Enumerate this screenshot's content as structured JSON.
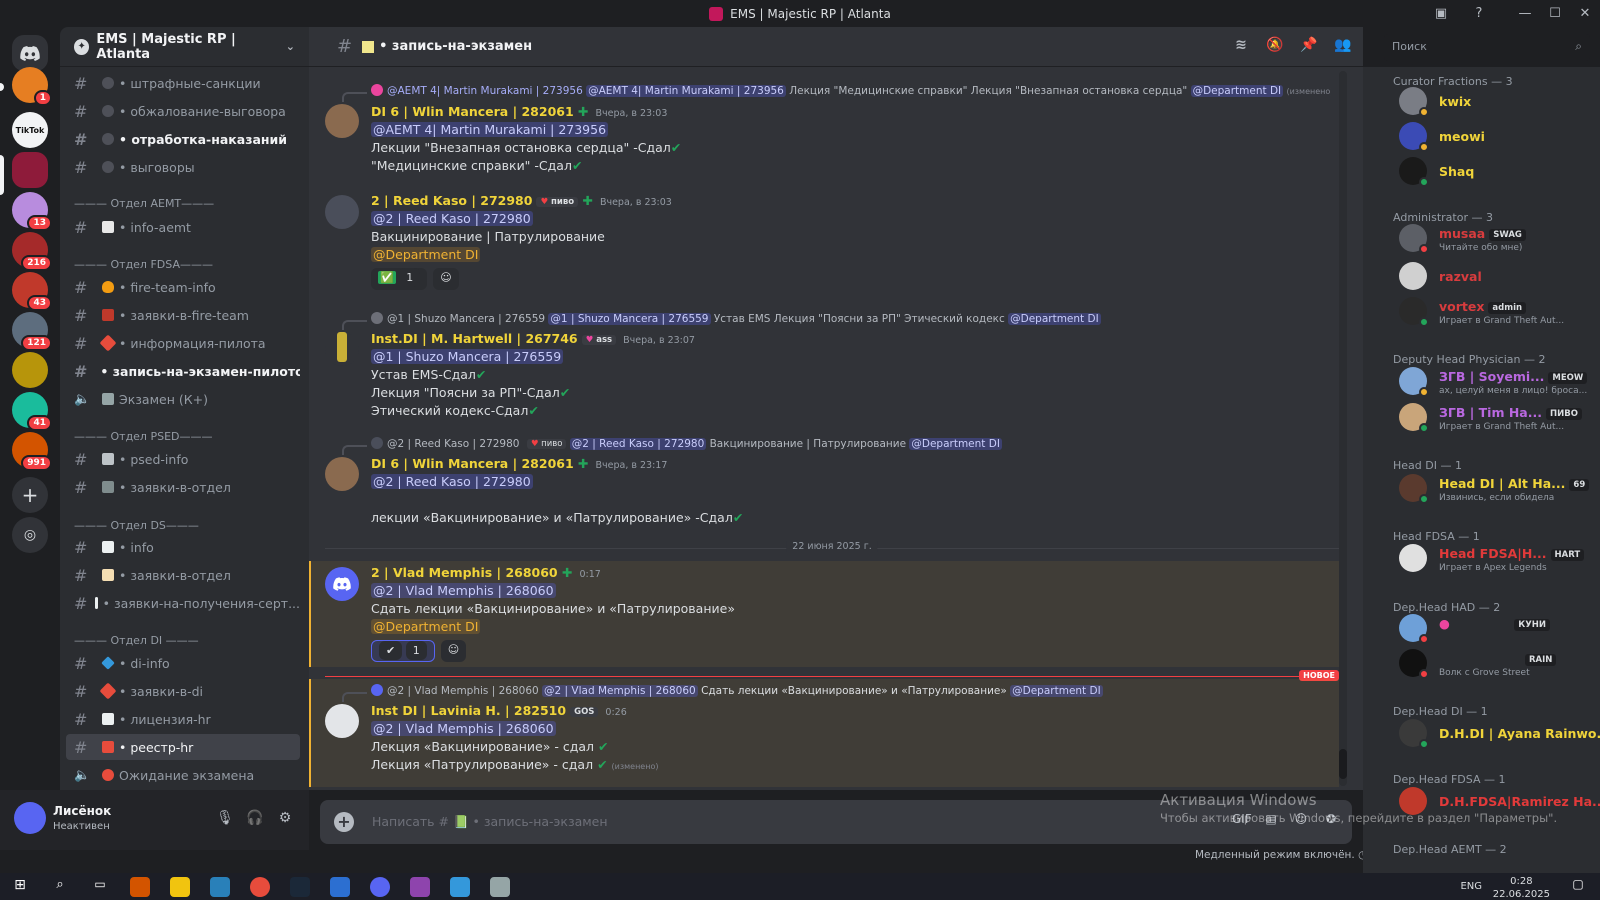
{
  "window": {
    "title": "EMS | Majestic RP | Atlanta",
    "controls": [
      "—",
      "☐",
      "✕"
    ]
  },
  "rail": {
    "badges": [
      "1",
      "13",
      "216",
      "43",
      "121",
      "41",
      "991"
    ],
    "thumb_text": "TikTok"
  },
  "sidebar": {
    "guild_name": "EMS | Majestic RP | Atlanta",
    "channels": [
      {
        "label": "• штрафные-санкции"
      },
      {
        "label": "• обжалование-выговора"
      },
      {
        "label": "• отработка-наказаний"
      },
      {
        "label": "• выговоры"
      },
      {
        "label": "• info-aemt"
      },
      {
        "label": "• fire-team-info"
      },
      {
        "label": "• заявки-в-fire-team"
      },
      {
        "label": "• информация-пилота"
      },
      {
        "label": "• запись-на-экзамен-пилотов"
      },
      {
        "label": "Экзамен (К+)"
      },
      {
        "label": "• psed-info"
      },
      {
        "label": "• заявки-в-отдел"
      },
      {
        "label": "• info"
      },
      {
        "label": "• заявки-в-отдел"
      },
      {
        "label": "• заявки-на-получения-серт..."
      },
      {
        "label": "• di-info"
      },
      {
        "label": "• заявки-в-di"
      },
      {
        "label": "• лицензия-hr"
      },
      {
        "label": "• реестр-hr"
      },
      {
        "label": "Ожидание экзамена"
      }
    ],
    "categories": [
      "——— Отдел AEMT———",
      "——— Отдел FDSA———",
      "——— Отдел PSED———",
      "——— Отдел DS———",
      "——— Отдел DI ———"
    ]
  },
  "user": {
    "name": "Лисёнок",
    "status": "Неактивен"
  },
  "channel": {
    "name": "• запись-на-экзамен",
    "composer_placeholder": "Написать # 📗 • запись-на-экзамен",
    "slowmode": "Медленный режим включён."
  },
  "search": {
    "placeholder": "Поиск"
  },
  "messages": [
    {
      "reply": {
        "author": "@AEMT 4| Martin Murakami | 273956",
        "text": "Лекция \"Медицинские справки\" Лекция \"Внезапная остановка сердца\"",
        "mention": "@AEMT 4| Martin Murakami | 273956",
        "role": "@Department DI",
        "edited": "(изменено)"
      },
      "author": "DI 6 | Wlin Mancera | 282061",
      "time": "Вчера, в 23:03",
      "lines": [
        "@AEMT 4| Martin Murakami | 273956",
        "Лекции \"Внезапная остановка сердца\"  -Сдал",
        " \"Медицинские справки\" -Сдал"
      ]
    },
    {
      "author": "2 | Reed Kaso | 272980",
      "tag": "пиво",
      "time": "Вчера, в 23:03",
      "lines": [
        "@2 | Reed Kaso | 272980",
        "Вакцинирование | Патрулирование",
        "@Department DI"
      ],
      "reactions": [
        "✅",
        "1"
      ]
    },
    {
      "reply": {
        "author": "@1 | Shuzo Mancera | 276559",
        "mention": "@1 | Shuzo Mancera | 276559",
        "text": "Устав EMS Лекция \"Поясни за РП\" Этический кодекс",
        "role": "@Department DI"
      },
      "author": "Inst.DI | M. Hartwell | 267746",
      "tag": "ass",
      "time": "Вчера, в 23:07",
      "lines": [
        "@1 | Shuzo Mancera | 276559",
        "Устав EMS-Сдал",
        "Лекция \"Поясни за РП\"-Сдал",
        "Этический кодекс-Сдал"
      ]
    },
    {
      "reply": {
        "author": "@2 | Reed Kaso | 272980",
        "tag": "пиво",
        "mention": "@2 | Reed Kaso | 272980",
        "text": "Вакцинирование | Патрулирование",
        "role": "@Department DI"
      },
      "author": "DI 6 | Wlin Mancera | 282061",
      "time": "Вчера, в 23:17",
      "lines": [
        "@2 | Reed Kaso | 272980",
        "лекции «Вакцинирование» и «Патрулирование» -Сдал"
      ]
    },
    {
      "author": "2 | Vlad Memphis | 268060",
      "time": "0:17",
      "lines": [
        "@2 | Vlad Memphis | 268060",
        "Сдать лекции «Вакцинирование» и «Патрулирование»",
        "@Department DI"
      ],
      "reactions": [
        "✔",
        "1"
      ]
    },
    {
      "reply": {
        "author": "@2 | Vlad Memphis | 268060",
        "mention": "@2 | Vlad Memphis | 268060",
        "text": "Сдать лекции «Вакцинирование» и «Патрулирование»",
        "role": "@Department DI"
      },
      "author": "Inst DI | Lavinia H. | 282510",
      "tag": "GOS",
      "time": "0:26",
      "lines": [
        "@2 | Vlad Memphis | 268060",
        "Лекция «Вакцинирование» - сдал",
        "Лекция «Патрулирование» - сдал"
      ],
      "edited": "(изменено)"
    }
  ],
  "date_divider": "22 июня 2025 г.",
  "new_divider": "НОВОЕ",
  "members": {
    "groups": [
      "Curator Fractions — 3",
      "Administrator — 3",
      "Deputy Head Physician — 2",
      "Head DI — 1",
      "Head FDSA — 1",
      "Dep.Head HAD — 2",
      "Dep.Head DI — 1",
      "Dep.Head FDSA — 1",
      "Dep.Head AEMT — 2"
    ],
    "list": [
      {
        "name": "kwix"
      },
      {
        "name": "meowi"
      },
      {
        "name": "Shaq"
      },
      {
        "name": "musaa",
        "tag": "SWAG",
        "activity": "Читайте обо мне)"
      },
      {
        "name": "razval"
      },
      {
        "name": "vortex",
        "tag": "admin",
        "activity": "Играет в Grand Theft Aut..."
      },
      {
        "name": "ЗГВ | Soyemi...",
        "tag": "MEOW",
        "activity": "ах, целуй меня в лицо! броса..."
      },
      {
        "name": "ЗГВ | Tim Ha...",
        "tag": "ПИВО",
        "activity": "Играет в Grand Theft Aut..."
      },
      {
        "name": "Head DI | Alt Ha...",
        "tag": "69",
        "activity": "Извинись, если обидела"
      },
      {
        "name": "Head FDSA|H...",
        "tag": "HART",
        "activity": "Играет в Apex Legends"
      },
      {
        "name": "",
        "tag": "КУНИ"
      },
      {
        "name": "",
        "tag": "RAIN",
        "activity": "Волк с Grove Street"
      },
      {
        "name": "D.H.DI | Ayana Rainwo..."
      },
      {
        "name": "D.H.FDSA|Ramirez Ha..."
      }
    ]
  },
  "watermark": {
    "line1": "Активация Windows",
    "line2": "Чтобы активировать Windows, перейдите в раздел \"Параметры\"."
  },
  "taskbar": {
    "lang": "ENG",
    "time": "0:28",
    "date": "22.06.2025"
  }
}
